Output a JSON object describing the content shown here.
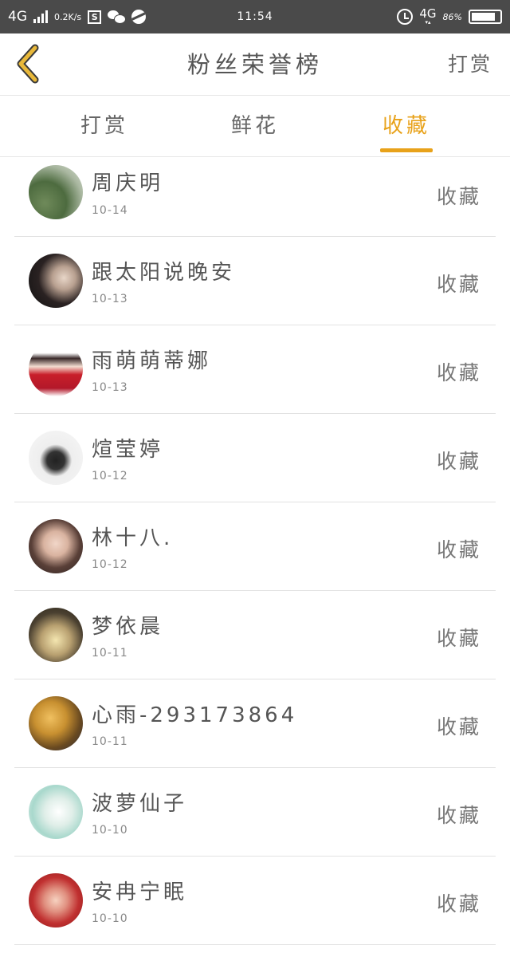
{
  "status_bar": {
    "network": "4G",
    "speed": "0.2K/s",
    "time": "11:54",
    "network_right": "4G",
    "battery": "86%"
  },
  "header": {
    "title": "粉丝荣誉榜",
    "action_label": "打赏"
  },
  "tabs": [
    {
      "label": "打赏",
      "active": false
    },
    {
      "label": "鲜花",
      "active": false
    },
    {
      "label": "收藏",
      "active": true
    }
  ],
  "accent_color": "#e8a21a",
  "fans": [
    {
      "name": "周庆明",
      "date": "10-14",
      "type": "收藏"
    },
    {
      "name": "跟太阳说晚安",
      "date": "10-13",
      "type": "收藏"
    },
    {
      "name": "雨萌萌蒂娜",
      "date": "10-13",
      "type": "收藏"
    },
    {
      "name": "煊莹婷",
      "date": "10-12",
      "type": "收藏"
    },
    {
      "name": "林十八.",
      "date": "10-12",
      "type": "收藏"
    },
    {
      "name": "梦依晨",
      "date": "10-11",
      "type": "收藏"
    },
    {
      "name": "心雨-293173864",
      "date": "10-11",
      "type": "收藏"
    },
    {
      "name": "波萝仙子",
      "date": "10-10",
      "type": "收藏"
    },
    {
      "name": "安冉宁眠",
      "date": "10-10",
      "type": "收藏"
    }
  ]
}
